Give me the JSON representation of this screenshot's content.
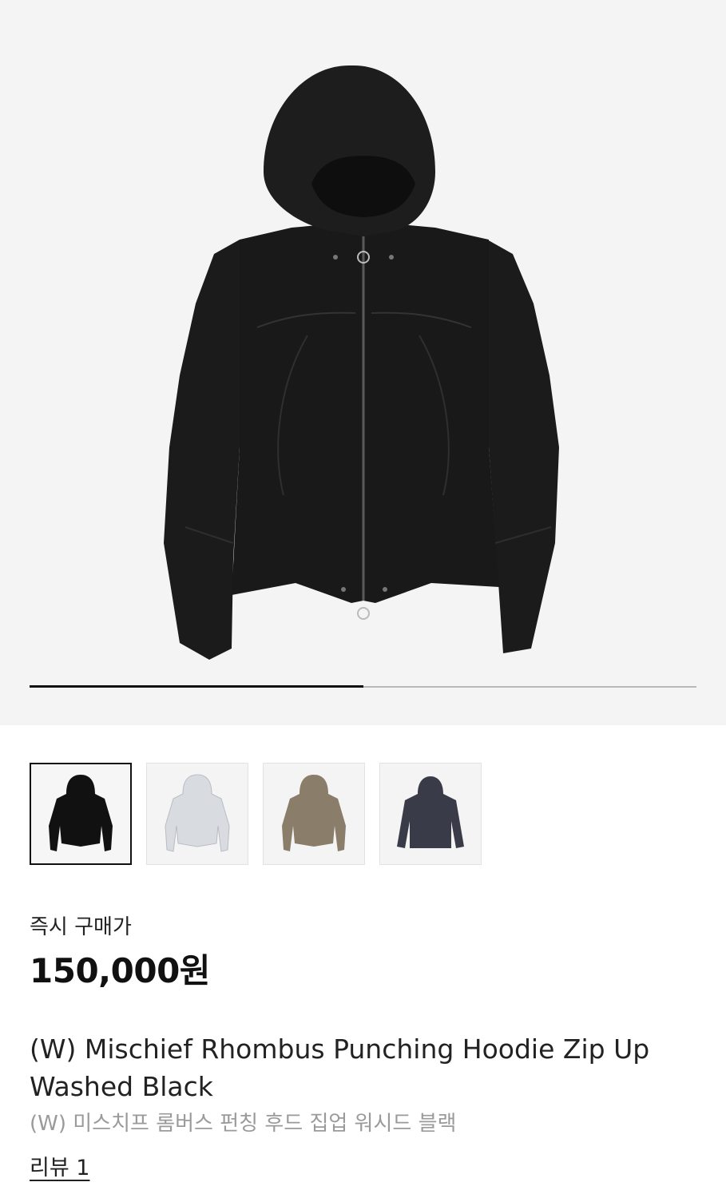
{
  "gallery": {
    "main_image_icon": "hooded-zip-jacket-black",
    "progress_fraction": 0.5,
    "thumbnails": [
      {
        "icon": "hooded-jacket-black",
        "color": "#111111",
        "selected": true
      },
      {
        "icon": "hooded-jacket-light-grey",
        "color": "#d8dbe0",
        "selected": false
      },
      {
        "icon": "hooded-jacket-washed-brown",
        "color": "#8a7d6a",
        "selected": false
      },
      {
        "icon": "hoodie-charcoal",
        "color": "#3a3b48",
        "selected": false
      }
    ]
  },
  "product": {
    "price_label": "즉시 구매가",
    "price": "150,000원",
    "title": "(W) Mischief Rhombus Punching Hoodie Zip Up Washed Black",
    "subtitle": "(W) 미스치프 롬버스 펀칭 후드 집업 워시드 블랙",
    "review_link": "리뷰 1"
  }
}
